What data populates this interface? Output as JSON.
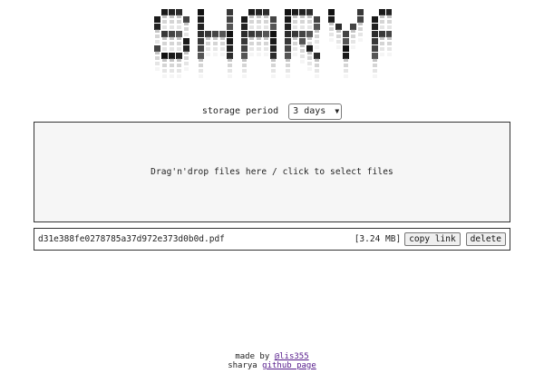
{
  "app": {
    "logo_text": "SHARYA"
  },
  "storage": {
    "label": "storage period",
    "selected": "3 days"
  },
  "dropzone": {
    "text": "Drag'n'drop files here / click to select files"
  },
  "files": [
    {
      "name": "d31e388fe0278785a37d972e373d0b0d.pdf",
      "size": "[3.24 MB]",
      "copy_label": "copy link",
      "delete_label": "delete"
    }
  ],
  "footer": {
    "made_by_prefix": "made by",
    "author": "@lis355",
    "line2_prefix": "sharya",
    "github_label": "github page"
  },
  "colors": {
    "dropzone_bg": "#f6f6f6",
    "border": "#333333",
    "link_visited": "#551a8b"
  }
}
